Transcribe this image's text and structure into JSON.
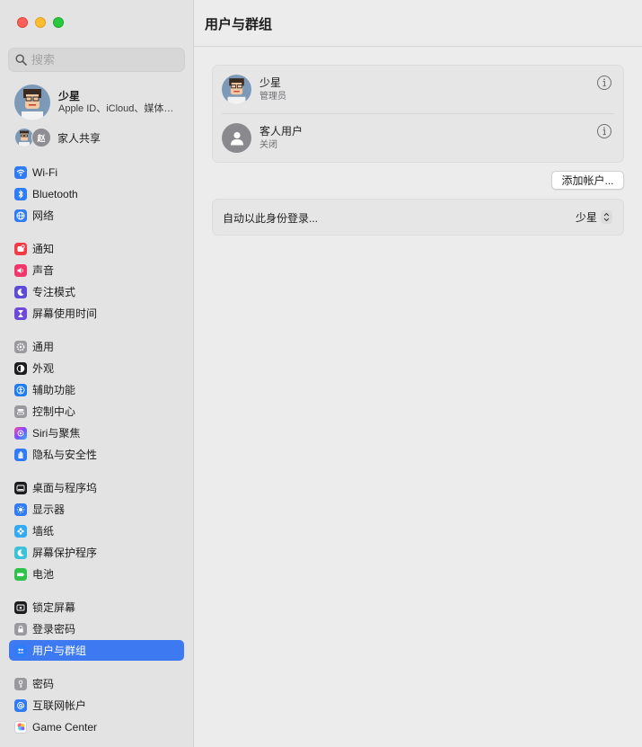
{
  "window": {
    "title": "用户与群组",
    "traffic_lights": {
      "close": "#fe5f57",
      "minimize": "#febc2e",
      "maximize": "#28c840"
    }
  },
  "sidebar": {
    "search": {
      "placeholder": "搜索",
      "value": ""
    },
    "account": {
      "name": "少星",
      "subtitle": "Apple ID、iCloud、媒体…"
    },
    "family": {
      "label": "家人共享",
      "badge": "赵"
    },
    "items": [
      {
        "id": "wifi",
        "label": "Wi-Fi",
        "icon": "wifi-icon",
        "color": "#2f7cf6"
      },
      {
        "id": "bluetooth",
        "label": "Bluetooth",
        "icon": "bluetooth-icon",
        "color": "#2f7cf6"
      },
      {
        "id": "network",
        "label": "网络",
        "icon": "globe-icon",
        "color": "#2f7cf6"
      },
      {
        "id": "notifications",
        "label": "通知",
        "icon": "bell-icon",
        "color": "#f33b45"
      },
      {
        "id": "sound",
        "label": "声音",
        "icon": "speaker-icon",
        "color": "#f3366a"
      },
      {
        "id": "focus",
        "label": "专注模式",
        "icon": "moon-icon",
        "color": "#5d4ad6"
      },
      {
        "id": "screen-time",
        "label": "屏幕使用时间",
        "icon": "hourglass-icon",
        "color": "#6e48d8"
      },
      {
        "id": "general",
        "label": "通用",
        "icon": "gear-icon",
        "color": "#9a9a9e"
      },
      {
        "id": "appearance",
        "label": "外观",
        "icon": "appearance-icon",
        "color": "#1d1d1f"
      },
      {
        "id": "accessibility",
        "label": "辅助功能",
        "icon": "accessibility-icon",
        "color": "#1f7cf0"
      },
      {
        "id": "control-center",
        "label": "控制中心",
        "icon": "control-center-icon",
        "color": "#9a9a9e"
      },
      {
        "id": "siri",
        "label": "Siri与聚焦",
        "icon": "siri-icon",
        "color": "#b03fd8"
      },
      {
        "id": "privacy",
        "label": "隐私与安全性",
        "icon": "hand-icon",
        "color": "#2f7cf6"
      },
      {
        "id": "desktop-dock",
        "label": "桌面与程序坞",
        "icon": "dock-icon",
        "color": "#1d1d1f"
      },
      {
        "id": "displays",
        "label": "显示器",
        "icon": "sun-icon",
        "color": "#2f7cf6"
      },
      {
        "id": "wallpaper",
        "label": "墙纸",
        "icon": "flower-icon",
        "color": "#35aaf0"
      },
      {
        "id": "screen-saver",
        "label": "屏幕保护程序",
        "icon": "screensaver-icon",
        "color": "#3cc2d6"
      },
      {
        "id": "battery",
        "label": "电池",
        "icon": "battery-icon",
        "color": "#30c14a"
      },
      {
        "id": "lock-screen",
        "label": "锁定屏幕",
        "icon": "lock-screen-icon",
        "color": "#1d1d1f"
      },
      {
        "id": "login-password",
        "label": "登录密码",
        "icon": "lock-icon",
        "color": "#9a9a9e"
      },
      {
        "id": "users-groups",
        "label": "用户与群组",
        "icon": "users-icon",
        "color": "#2f7cf6",
        "selected": true
      },
      {
        "id": "passwords",
        "label": "密码",
        "icon": "key-icon",
        "color": "#9a9a9e"
      },
      {
        "id": "internet-accounts",
        "label": "互联网帐户",
        "icon": "at-icon",
        "color": "#2f7cf6"
      },
      {
        "id": "game-center",
        "label": "Game Center",
        "icon": "game-center-icon",
        "color": "#ffffff"
      }
    ]
  },
  "main": {
    "title": "用户与群组",
    "users": [
      {
        "name": "少星",
        "role": "管理员"
      },
      {
        "name": "客人用户",
        "role": "关闭"
      }
    ],
    "add_account_label": "添加帐户...",
    "auto_login": {
      "label": "自动以此身份登录...",
      "value": "少星"
    }
  }
}
